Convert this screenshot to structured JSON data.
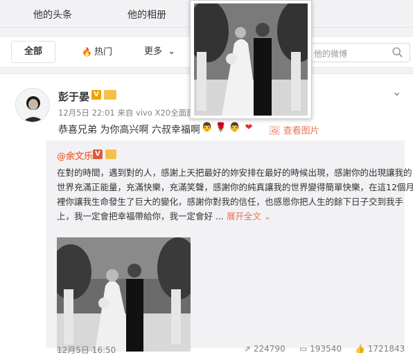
{
  "nav": {
    "tabs": [
      "他的头条",
      "他的相册"
    ]
  },
  "filter": {
    "all": "全部",
    "hot": "热门",
    "more": "更多",
    "search_placeholder": "他的微博"
  },
  "post": {
    "username": "彭于晏",
    "vip": "V",
    "meta": "12月5日 22:01 来自 vivo X20全面屏",
    "text": "恭喜兄弟 为你高兴啊 六叔幸福啊",
    "see_image": "查看图片",
    "emojis": [
      "👨",
      "🌹",
      "👨",
      "❤"
    ]
  },
  "repost": {
    "username": "@余文乐",
    "vip": "V",
    "lines": [
      "在對的時間，遇到對的人，感謝上天把最好的妳安排在最好的時候出現，感謝你的出現讓我的",
      "世界充滿正能量，充滿快樂，充滿笑聲，感謝你的純真讓我的世界變得簡單快樂，在這12個月",
      "裡你讓我生命發生了巨大的變化，感謝你對我的信任，也感恩你把人生的餘下日子交到我手",
      "上，我一定會把幸福帶給你，我一定會好 ..."
    ],
    "expand": "展开全文",
    "date": "12月5日 16:50",
    "reposts": "224790",
    "comments": "193540",
    "likes": "1721843"
  },
  "colors": {
    "accent": "#eb7350",
    "hot": "#fa7d3c",
    "vip": "#f0a000"
  }
}
